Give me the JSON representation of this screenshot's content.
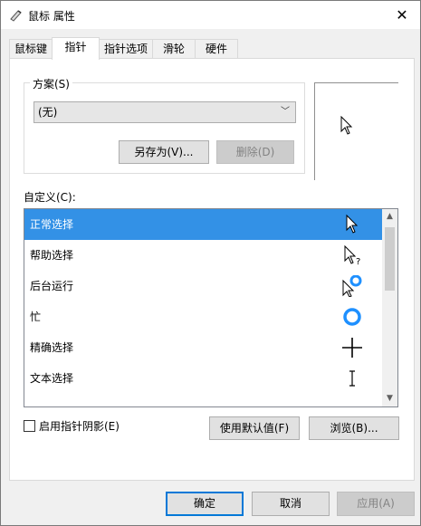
{
  "window": {
    "title": "鼠标 属性",
    "close_glyph": "✕"
  },
  "tabs": [
    {
      "label": "鼠标键"
    },
    {
      "label": "指针"
    },
    {
      "label": "指针选项"
    },
    {
      "label": "滑轮"
    },
    {
      "label": "硬件"
    }
  ],
  "scheme": {
    "label": "方案(S)",
    "selected": "(无)",
    "save_as_label": "另存为(V)...",
    "delete_label": "删除(D)"
  },
  "customize": {
    "label": "自定义(C):",
    "items": [
      {
        "label": "正常选择",
        "icon": "arrow-cursor-icon"
      },
      {
        "label": "帮助选择",
        "icon": "help-cursor-icon"
      },
      {
        "label": "后台运行",
        "icon": "working-cursor-icon"
      },
      {
        "label": "忙",
        "icon": "busy-cursor-icon"
      },
      {
        "label": "精确选择",
        "icon": "crosshair-cursor-icon"
      },
      {
        "label": "文本选择",
        "icon": "text-cursor-icon"
      },
      {
        "label": "",
        "icon": "handwriting-cursor-icon"
      }
    ]
  },
  "options": {
    "shadow_label": "启用指针阴影(E)",
    "default_label": "使用默认值(F)",
    "browse_label": "浏览(B)..."
  },
  "footer": {
    "ok_label": "确定",
    "cancel_label": "取消",
    "apply_label": "应用(A)"
  },
  "colors": {
    "selection": "#3391e6",
    "accent": "#0078d7",
    "busy": "#1e90ff"
  }
}
